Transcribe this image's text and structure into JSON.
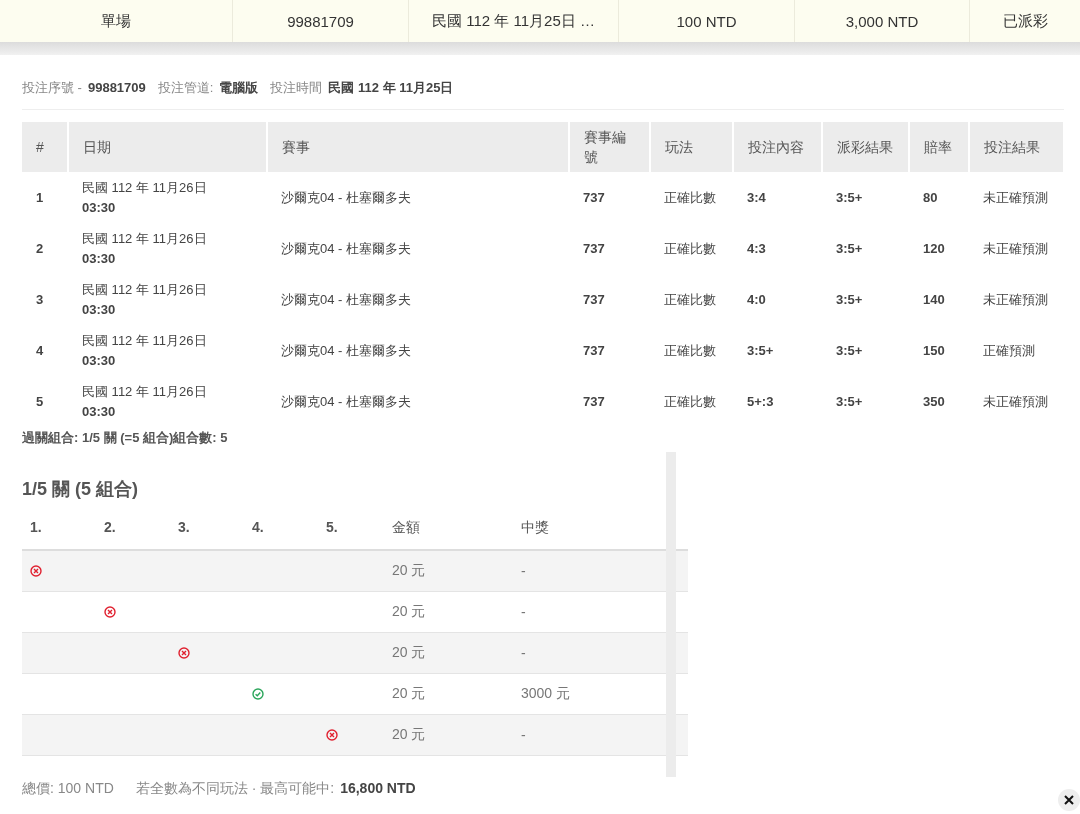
{
  "summary_bar": {
    "cells": [
      "單場",
      "99881709",
      "民國 112 年 11月25日 …",
      "100 NTD",
      "3,000 NTD",
      "已派彩"
    ]
  },
  "bet_info": [
    {
      "label": "投注序號 -",
      "value": "99881709"
    },
    {
      "label": "投注管道:",
      "value": "電腦版"
    },
    {
      "label": "投注時間",
      "value": "民國 112 年 11月25日"
    }
  ],
  "table": {
    "columns": [
      "#",
      "日期",
      "賽事",
      "賽事編號",
      "玩法",
      "投注內容",
      "派彩結果",
      "賠率",
      "投注結果"
    ],
    "rows": [
      {
        "no": "1",
        "date": "民國 112 年 11月26日",
        "time": "03:30",
        "match": "沙爾克04 - 杜塞爾多夫",
        "code": "737",
        "play": "正確比數",
        "pick": "3:4",
        "result": "3:5+",
        "odds": "80",
        "outcome": "未正確預測"
      },
      {
        "no": "2",
        "date": "民國 112 年 11月26日",
        "time": "03:30",
        "match": "沙爾克04 - 杜塞爾多夫",
        "code": "737",
        "play": "正確比數",
        "pick": "4:3",
        "result": "3:5+",
        "odds": "120",
        "outcome": "未正確預測"
      },
      {
        "no": "3",
        "date": "民國 112 年 11月26日",
        "time": "03:30",
        "match": "沙爾克04 - 杜塞爾多夫",
        "code": "737",
        "play": "正確比數",
        "pick": "4:0",
        "result": "3:5+",
        "odds": "140",
        "outcome": "未正確預測"
      },
      {
        "no": "4",
        "date": "民國 112 年 11月26日",
        "time": "03:30",
        "match": "沙爾克04 - 杜塞爾多夫",
        "code": "737",
        "play": "正確比數",
        "pick": "3:5+",
        "result": "3:5+",
        "odds": "150",
        "outcome": "正確預測"
      },
      {
        "no": "5",
        "date": "民國 112 年 11月26日",
        "time": "03:30",
        "match": "沙爾克04 - 杜塞爾多夫",
        "code": "737",
        "play": "正確比數",
        "pick": "5+:3",
        "result": "3:5+",
        "odds": "350",
        "outcome": "未正確預測"
      }
    ]
  },
  "parlay_summary": "過關組合: 1/5 關 (=5 組合)組合數: 5",
  "combination": {
    "title": "1/5 關 (5 組合)",
    "columns": [
      "1.",
      "2.",
      "3.",
      "4.",
      "5.",
      "金額",
      "中獎"
    ],
    "rows": [
      {
        "legs": [
          {
            "kind": "miss"
          },
          {
            "kind": "blank"
          },
          {
            "kind": "blank"
          },
          {
            "kind": "blank"
          },
          {
            "kind": "blank"
          }
        ],
        "amount": "20 元",
        "prize": "-"
      },
      {
        "legs": [
          {
            "kind": "blank"
          },
          {
            "kind": "miss"
          },
          {
            "kind": "blank"
          },
          {
            "kind": "blank"
          },
          {
            "kind": "blank"
          }
        ],
        "amount": "20 元",
        "prize": "-"
      },
      {
        "legs": [
          {
            "kind": "blank"
          },
          {
            "kind": "blank"
          },
          {
            "kind": "miss"
          },
          {
            "kind": "blank"
          },
          {
            "kind": "blank"
          }
        ],
        "amount": "20 元",
        "prize": "-"
      },
      {
        "legs": [
          {
            "kind": "blank"
          },
          {
            "kind": "blank"
          },
          {
            "kind": "blank"
          },
          {
            "kind": "hit"
          },
          {
            "kind": "blank"
          }
        ],
        "amount": "20 元",
        "prize": "3000 元"
      },
      {
        "legs": [
          {
            "kind": "blank"
          },
          {
            "kind": "blank"
          },
          {
            "kind": "blank"
          },
          {
            "kind": "blank"
          },
          {
            "kind": "miss"
          }
        ],
        "amount": "20 元",
        "prize": "-"
      }
    ]
  },
  "footer": {
    "total_label": "總價:",
    "total": "100 NTD",
    "max_label": "若全數為不同玩法 · 最高可能中:",
    "max": "16,800 NTD"
  }
}
